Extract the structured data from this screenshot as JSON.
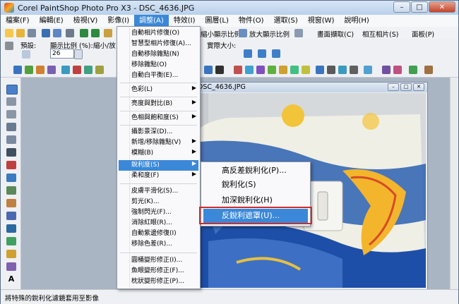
{
  "window": {
    "title": "Corel PaintShop Photo Pro X3 - DSC_4636.JPG"
  },
  "menubar": [
    "檔案(F)",
    "編輯(E)",
    "檢視(V)",
    "影像(I)",
    "調整(A)",
    "特效(I)",
    "圖層(L)",
    "物件(O)",
    "選取(S)",
    "視窗(W)",
    "說明(H)"
  ],
  "toolbar1": {
    "zoom_out_label": "縮小顯示比例",
    "zoom_in_label": "放大顯示比例",
    "screen_capture_label": "畫面擷取(C)",
    "share_photo_label": "相互相片(S)",
    "panel_label": "面板(P)"
  },
  "toolbar2": {
    "preset_label": "預設:",
    "zoom_label": "顯示比例 (%):",
    "zoom_value": "26",
    "zoom_inout_label": "縮小/放",
    "actual_size_label": "實際大小:"
  },
  "adjust_menu": {
    "items": [
      "自動相片修復(O)",
      "智慧型相片修復(A)...",
      "自動移除雜點(N)",
      "移除雜點(O)",
      "自動白平衡(E)...",
      "色彩(L)",
      "亮度與對比(B)",
      "色相與飽和度(S)",
      "攝影景深(D)...",
      "新增/移除雜點(V)",
      "模糊(B)",
      "銳利度(S)",
      "柔和度(F)",
      "皮膚平滑化(S)...",
      "剪光(K)...",
      "強制閃光(F)...",
      "消除紅眼(R)...",
      "自動紫邊修復(I)",
      "移除色差(R)...",
      "圓桶變形修正(I)...",
      "魚眼變形修正(F)...",
      "枕狀變形修正(P)..."
    ]
  },
  "sharpen_submenu": {
    "items": [
      "高反差銳利化(P)...",
      "銳利化(S)",
      "加深銳利化(H)",
      "反銳利遮罩(U)..."
    ]
  },
  "document": {
    "title": "DSC_4636.JPG"
  },
  "status": {
    "text": "將特殊的銳利化濾鏡套用至影像"
  },
  "colors": {
    "accent": "#3b88d8",
    "highlight_box": "#d02a2a"
  }
}
